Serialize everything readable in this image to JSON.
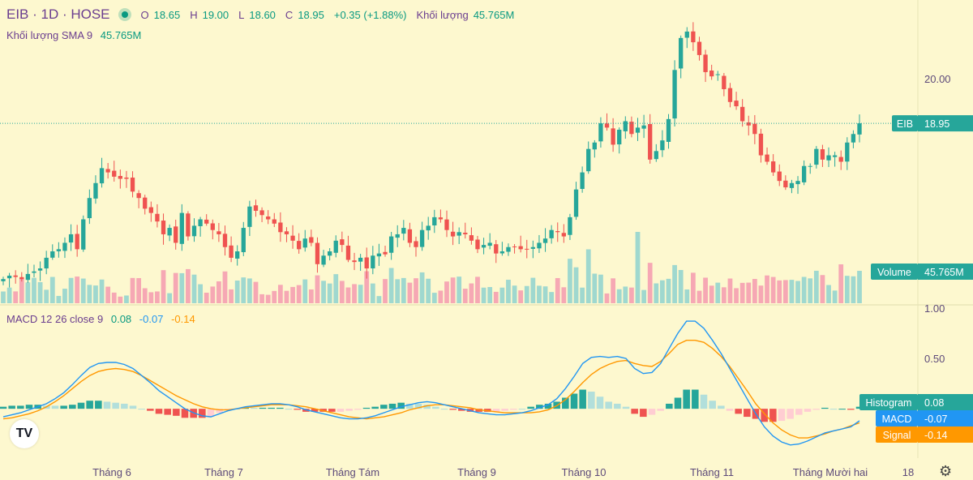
{
  "header": {
    "symbol": "EIB · 1D · HOSE",
    "open_label": "O",
    "open": "18.65",
    "high_label": "H",
    "high": "19.00",
    "low_label": "L",
    "low": "18.60",
    "close_label": "C",
    "close": "18.95",
    "change": "+0.35 (+1.88%)",
    "volume_label": "Khối lượng",
    "volume": "45.765M"
  },
  "sma": {
    "label": "Khối lượng SMA 9",
    "value": "45.765M"
  },
  "macd_header": {
    "label": "MACD 12 26 close 9",
    "macd": "0.08",
    "signal": "-0.07",
    "hist": "-0.14"
  },
  "colors": {
    "up": "#26a69a",
    "down": "#ef5350",
    "vol_up": "#9fd8cf",
    "vol_down": "#f6a8b4",
    "hist_up_strong": "#26a69a",
    "hist_up_weak": "#b2dfdb",
    "hist_down_strong": "#ef5350",
    "hist_down_weak": "#ffcdd2",
    "macd_line": "#2196f3",
    "signal_line": "#ff9800",
    "background": "#fdf8cf",
    "text_purple": "#6a3d8f"
  },
  "chart_data": {
    "type": "candlestick",
    "xaxis_labels": [
      "Tháng 6",
      "Tháng 7",
      "Tháng Tám",
      "Tháng 9",
      "Tháng 10",
      "Tháng 11",
      "Tháng Mười hai",
      "18"
    ],
    "price_ticks": [
      "20.00"
    ],
    "macd_ticks": [
      "1.00",
      "0.50"
    ],
    "price_tag": {
      "label": "EIB",
      "value": "18.95"
    },
    "volume_tag": {
      "label": "Volume",
      "value": "45.765M"
    },
    "hist_tag": {
      "label": "Histogram",
      "value": "0.08"
    },
    "macd_tag": {
      "label": "MACD",
      "value": "-0.07"
    },
    "signal_tag": {
      "label": "Signal",
      "value": "-0.14"
    },
    "ylim_price": [
      15.0,
      21.65
    ],
    "ylim_macd": [
      -0.45,
      1.0
    ],
    "last_close": 18.95,
    "price_closes": [
      15.3,
      15.38,
      15.35,
      15.3,
      15.42,
      15.48,
      15.55,
      15.8,
      15.95,
      16.0,
      16.15,
      16.35,
      16.0,
      16.7,
      17.2,
      17.55,
      17.9,
      17.8,
      17.7,
      17.65,
      17.65,
      17.35,
      17.2,
      16.95,
      16.85,
      16.65,
      16.35,
      16.5,
      16.15,
      16.85,
      16.3,
      16.55,
      16.7,
      16.6,
      16.45,
      16.35,
      16.05,
      15.8,
      15.95,
      16.5,
      17.0,
      16.9,
      16.8,
      16.7,
      16.6,
      16.4,
      16.35,
      16.2,
      16.0,
      16.25,
      16.15,
      15.65,
      15.85,
      15.95,
      16.2,
      16.1,
      15.75,
      15.7,
      15.8,
      15.55,
      15.85,
      15.9,
      15.88,
      16.3,
      16.35,
      16.5,
      16.15,
      16.05,
      16.45,
      16.55,
      16.75,
      16.7,
      16.45,
      16.3,
      16.4,
      16.35,
      16.2,
      16.0,
      16.1,
      16.15,
      15.9,
      15.95,
      16.05,
      16.05,
      16.0,
      16.0,
      16.05,
      16.15,
      16.25,
      16.45,
      16.4,
      16.3,
      16.75,
      17.4,
      17.8,
      18.35,
      18.5,
      18.95,
      18.85,
      18.45,
      18.8,
      19.0,
      18.7,
      18.85,
      18.9,
      18.1,
      18.3,
      18.55,
      19.05,
      20.2,
      20.95,
      21.1,
      20.85,
      20.55,
      20.15,
      20.05,
      20.1,
      19.75,
      19.45,
      19.35,
      19.0,
      18.9,
      18.7,
      18.2,
      18.05,
      17.8,
      17.6,
      17.45,
      17.55,
      17.6,
      17.95,
      17.95,
      18.35,
      18.1,
      18.2,
      18.2,
      18.05,
      18.5,
      18.7,
      18.95
    ],
    "volume_ticks_note": "",
    "macd_values": [
      -0.08,
      -0.06,
      -0.04,
      -0.01,
      0.02,
      0.05,
      0.1,
      0.16,
      0.24,
      0.33,
      0.41,
      0.45,
      0.46,
      0.46,
      0.44,
      0.4,
      0.33,
      0.26,
      0.18,
      0.12,
      0.06,
      0.0,
      -0.04,
      -0.07,
      -0.08,
      -0.05,
      -0.02,
      0.0,
      0.02,
      0.03,
      0.04,
      0.05,
      0.05,
      0.04,
      0.02,
      -0.01,
      -0.03,
      -0.05,
      -0.07,
      -0.09,
      -0.1,
      -0.1,
      -0.09,
      -0.07,
      -0.04,
      -0.01,
      0.02,
      0.04,
      0.06,
      0.07,
      0.06,
      0.04,
      0.02,
      0.0,
      -0.02,
      -0.04,
      -0.05,
      -0.06,
      -0.06,
      -0.05,
      -0.04,
      -0.02,
      0.01,
      0.04,
      0.1,
      0.2,
      0.32,
      0.45,
      0.51,
      0.52,
      0.51,
      0.52,
      0.5,
      0.4,
      0.35,
      0.36,
      0.45,
      0.6,
      0.75,
      0.87,
      0.87,
      0.8,
      0.68,
      0.55,
      0.4,
      0.25,
      0.1,
      -0.05,
      -0.18,
      -0.27,
      -0.33,
      -0.36,
      -0.35,
      -0.32,
      -0.28,
      -0.24,
      -0.22,
      -0.2,
      -0.18,
      -0.12
    ],
    "signal_values": [
      -0.1,
      -0.09,
      -0.07,
      -0.05,
      -0.02,
      0.02,
      0.07,
      0.13,
      0.2,
      0.27,
      0.33,
      0.37,
      0.39,
      0.4,
      0.39,
      0.37,
      0.33,
      0.28,
      0.23,
      0.18,
      0.13,
      0.09,
      0.05,
      0.02,
      0.0,
      -0.01,
      -0.01,
      0.0,
      0.01,
      0.02,
      0.03,
      0.04,
      0.04,
      0.04,
      0.03,
      0.02,
      0.0,
      -0.02,
      -0.04,
      -0.06,
      -0.08,
      -0.09,
      -0.1,
      -0.09,
      -0.08,
      -0.06,
      -0.04,
      -0.01,
      0.01,
      0.03,
      0.04,
      0.04,
      0.03,
      0.02,
      0.01,
      -0.01,
      -0.02,
      -0.03,
      -0.04,
      -0.04,
      -0.04,
      -0.04,
      -0.03,
      -0.01,
      0.03,
      0.09,
      0.17,
      0.26,
      0.34,
      0.4,
      0.44,
      0.47,
      0.48,
      0.45,
      0.43,
      0.42,
      0.47,
      0.55,
      0.64,
      0.68,
      0.68,
      0.66,
      0.6,
      0.52,
      0.42,
      0.3,
      0.18,
      0.05,
      -0.05,
      -0.14,
      -0.21,
      -0.26,
      -0.29,
      -0.29,
      -0.27,
      -0.25,
      -0.22,
      -0.2,
      -0.17,
      -0.14
    ]
  }
}
